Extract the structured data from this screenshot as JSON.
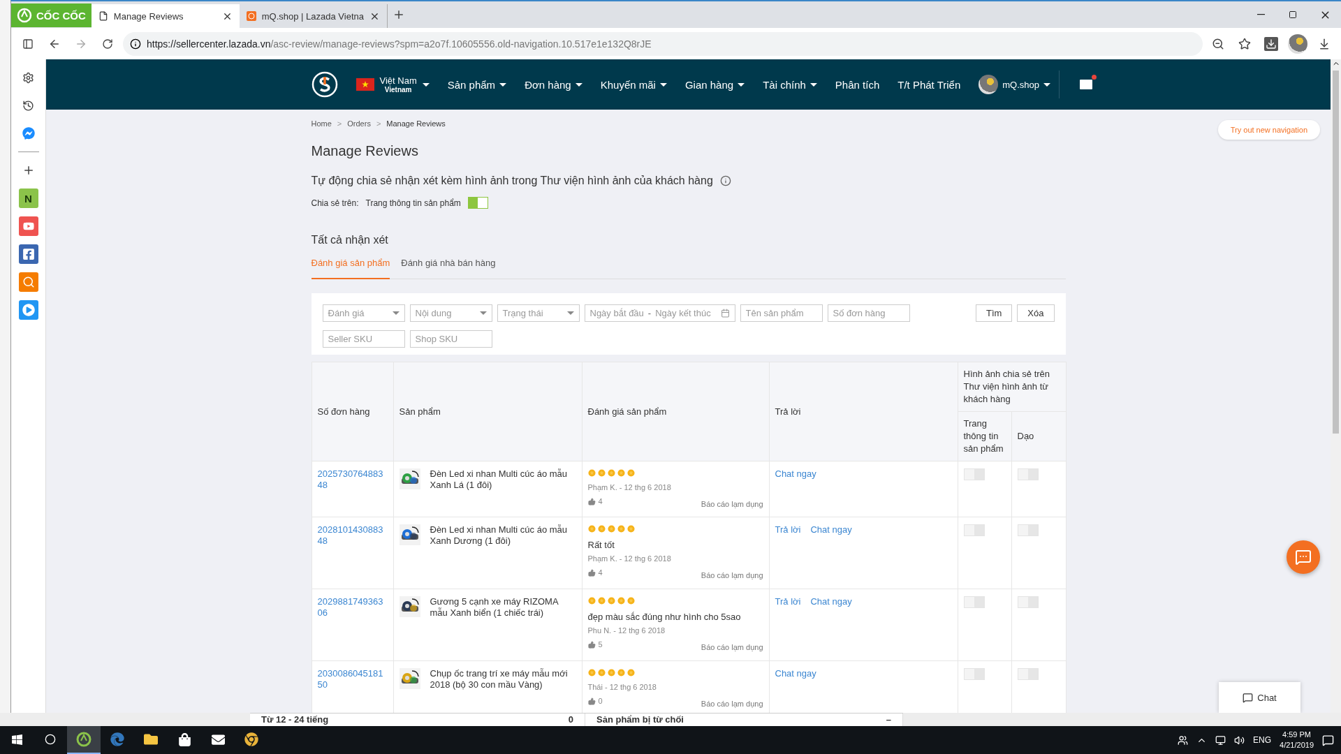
{
  "browser": {
    "logo": "CỐC CỐC",
    "tabs": [
      {
        "title": "Manage Reviews",
        "selected": true
      },
      {
        "title": "mQ.shop | Lazada Vietna",
        "selected": false
      }
    ],
    "url_host": "https://sellercenter.lazada.vn",
    "url_path": "/asc-review/manage-reviews?spm=a2o7f.10605556.old-navigation.10.517e1e132Q8rJE",
    "sidebar_app": "N"
  },
  "nav": {
    "country": "Việt Nam",
    "country_sub": "Vietnam",
    "items": [
      {
        "label": "Sản phẩm",
        "dropdown": true
      },
      {
        "label": "Đơn hàng",
        "dropdown": true
      },
      {
        "label": "Khuyến mãi",
        "dropdown": true
      },
      {
        "label": "Gian hàng",
        "dropdown": true
      },
      {
        "label": "Tài chính",
        "dropdown": true
      },
      {
        "label": "Phân tích",
        "dropdown": false
      },
      {
        "label": "T/t Phát Triển",
        "dropdown": false
      }
    ],
    "account": "mQ.shop",
    "mail_unread": true
  },
  "try_navigation": "Try out new navigation",
  "breadcrumb": [
    {
      "label": "Home"
    },
    {
      "separator": ">",
      "label": "Orders"
    },
    {
      "separator": ">",
      "label": "Manage Reviews"
    }
  ],
  "title": "Manage Reviews",
  "share": {
    "heading": "Tự động chia sẻ nhận xét kèm hình ảnh trong Thư viện hình ảnh của khách hàng",
    "label": "Chia sẻ trên:",
    "option": "Trang thông tin sản phẩm",
    "on": true
  },
  "section_title": "Tất cả nhận xét",
  "tabs": [
    {
      "label": "Đánh giá sản phẩm",
      "selected": true
    },
    {
      "label": "Đánh giá nhà bán hàng",
      "selected": false
    }
  ],
  "filters": [
    {
      "kind": "select",
      "placeholder": "Đánh giá"
    },
    {
      "kind": "select",
      "placeholder": "Nội dung"
    },
    {
      "kind": "select",
      "placeholder": "Trạng thái"
    },
    {
      "kind": "daterange",
      "placeholder": "Ngày bắt đầu",
      "separator": "-",
      "placeholder_end": "Ngày kết thúc"
    },
    {
      "kind": "text",
      "placeholder": "Tên sản phẩm"
    },
    {
      "kind": "text",
      "placeholder": "Số đơn hàng"
    },
    {
      "kind": "text",
      "placeholder": "Seller SKU"
    },
    {
      "kind": "text",
      "placeholder": "Shop SKU"
    }
  ],
  "filter_buttons": [
    "Tìm",
    "Xóa"
  ],
  "table": {
    "columns": [
      "Số đơn hàng",
      "Sản phẩm",
      "Đánh giá sản phẩm",
      "Trả lời"
    ],
    "group_column": "Hình ảnh chia sẻ trên Thư viện hình ảnh từ khách hàng",
    "sub_columns": [
      "Trang thông tin sản phẩm",
      "Dạo"
    ],
    "rows": [
      {
        "order": "2025730764883 48",
        "product": "Đèn Led xi nhan Multi cúc áo mẫu Xanh Lá (1 đôi)",
        "stars": 5,
        "author": "Phạm K. - 12 thg 6 2018",
        "likes": "4",
        "report": "Báo cáo lạm dụng",
        "actions": [
          "Chat ngay"
        ],
        "share_product": false,
        "share_explore": false
      },
      {
        "order": "2028101430883 48",
        "product": "Đèn Led xi nhan Multi cúc áo mẫu Xanh Dương (1 đôi)",
        "stars": 5,
        "comment": "Rất tốt",
        "author": "Phạm K. - 12 thg 6 2018",
        "likes": "4",
        "report": "Báo cáo lạm dụng",
        "actions": [
          "Trả lời",
          "Chat ngay"
        ],
        "share_product": false,
        "share_explore": false
      },
      {
        "order": "2029881749363 06",
        "product": "Gương 5 cạnh xe máy RIZOMA mẫu Xanh biển (1 chiếc trái)",
        "stars": 5,
        "comment": "đẹp màu sắc đúng như hình cho 5sao",
        "author": "Phu N. - 12 thg 6 2018",
        "likes": "5",
        "report": "Báo cáo lạm dụng",
        "actions": [
          "Trả lời",
          "Chat ngay"
        ],
        "share_product": false,
        "share_explore": false
      },
      {
        "order": "2030086045181 50",
        "product": "Chụp ốc trang trí xe máy mẫu mới 2018 (bộ 30 con mầu Vàng)",
        "stars": 5,
        "author": "Thái - 12 thg 6 2018",
        "likes": "0",
        "report": "Báo cáo lạm dụng",
        "actions": [
          "Chat ngay"
        ],
        "share_product": false,
        "share_explore": false
      }
    ]
  },
  "chat": "Chat",
  "back_window": {
    "left": "Từ 12 - 24 tiếng",
    "left_count": "0",
    "right": "Sản phẩm bị từ chối",
    "right_mark": "–"
  },
  "taskbar": {
    "language": "ENG",
    "time": "4:59 PM",
    "date": "4/21/2019"
  }
}
